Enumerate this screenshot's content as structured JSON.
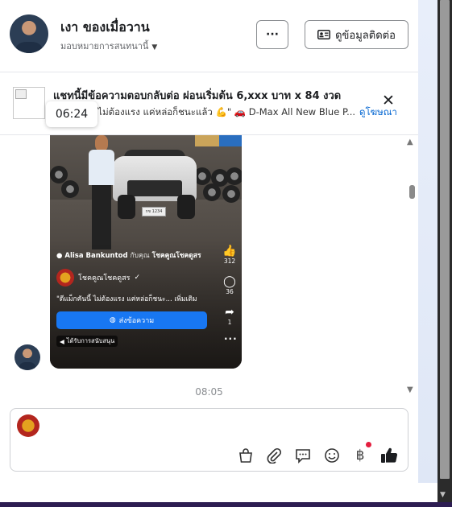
{
  "header": {
    "name": "เงา ของเมื่อวาน",
    "subtitle": "มอบหมายการสนทนานี้",
    "more_label": "···",
    "contact_label": "ดูข้อมูลติดต่อ"
  },
  "ad": {
    "title": "แชทนี้มีข้อความตอบกลับต่อ ผ่อนเริ่มต้น 6,xxx บาท x 84 งวด",
    "description": "\"ไม่ต้องแรง แค่หล่อก็ชนะแล้ว 💪\" 🚗 D-Max All New Blue P...",
    "link": "ดูโฆษณา",
    "close": "✕",
    "tooltip_time": "06:24"
  },
  "video": {
    "author": "Alisa Bankuntod",
    "author_with": "กับคุณ",
    "page": "โชคคูณโชคดูสร",
    "brand": "โชคคูณโชคดูสร",
    "brand_check": "✓",
    "caption": "\"ดีแม็กคันนี้ ไม่ต้องแรง แค่หล่อก็ชนะ... เพิ่มเติม",
    "send_label": "ส่งข้อความ",
    "note": "ได้รับการสนับสนุน",
    "plate": "กข 1234",
    "likes": "312",
    "comments": "36",
    "shares": "1"
  },
  "chat": {
    "timestamp": "08:05"
  },
  "composer": {
    "tools": [
      "bag-icon",
      "attachment-icon",
      "quick-reply-icon",
      "emoji-icon",
      "baht-icon",
      "thumbs-up-icon"
    ]
  },
  "colors": {
    "accent": "#1877f2",
    "link": "#0064d1",
    "notification": "#e41e3f"
  }
}
